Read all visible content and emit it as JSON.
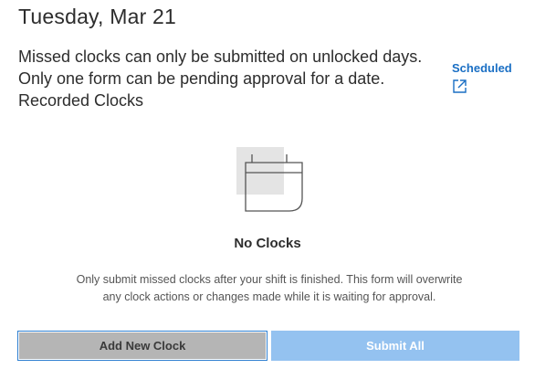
{
  "header": {
    "date_title": "Tuesday, Mar 21"
  },
  "info": {
    "line1": "Missed clocks can only be submitted on unlocked days.",
    "line2": "Only one form can be pending approval for a date.",
    "line3": "Recorded Clocks"
  },
  "scheduled_link": {
    "label": "Scheduled",
    "icon": "external-link-icon",
    "color": "#1a6fc4"
  },
  "empty_state": {
    "icon": "calendar-icon",
    "title": "No Clocks",
    "description_line1": "Only submit missed clocks after your shift is finished. This form will overwrite",
    "description_line2": "any clock actions or changes made while it is waiting for approval."
  },
  "actions": {
    "add_label": "Add New Clock",
    "submit_label": "Submit All"
  },
  "colors": {
    "add_button_bg": "#b5b5b5",
    "submit_button_bg": "#94c2f0",
    "focus_outline": "#2f80d1"
  }
}
